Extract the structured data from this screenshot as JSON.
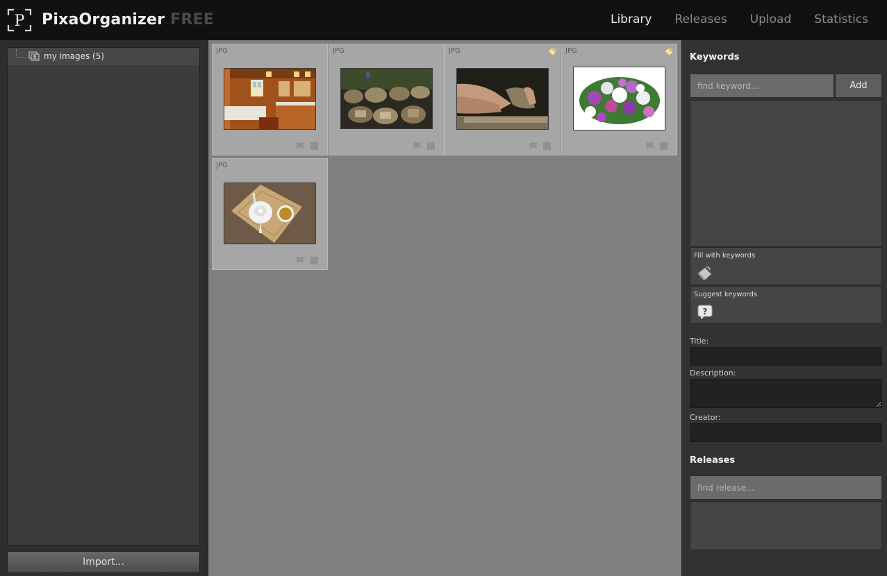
{
  "app": {
    "name": "PixaOrganizer",
    "edition": "FREE",
    "logo_letter": "P"
  },
  "nav": {
    "items": [
      {
        "label": "Library",
        "active": true
      },
      {
        "label": "Releases",
        "active": false
      },
      {
        "label": "Upload",
        "active": false
      },
      {
        "label": "Statistics",
        "active": false
      }
    ]
  },
  "library": {
    "folder_label": "my images (5)",
    "import_label": "Import..."
  },
  "images": [
    {
      "type": "JPG",
      "tagged": false,
      "subject": "wooden-bathroom"
    },
    {
      "type": "JPG",
      "tagged": false,
      "subject": "clay-pottery"
    },
    {
      "type": "JPG",
      "tagged": true,
      "subject": "potter-hands"
    },
    {
      "type": "JPG",
      "tagged": true,
      "subject": "flower-bouquet"
    },
    {
      "type": "JPG",
      "tagged": false,
      "subject": "teapot-on-mat"
    }
  ],
  "keywords": {
    "title": "Keywords",
    "search_placeholder": "find keyword...",
    "add_label": "Add",
    "fill_label": "Fill with keywords",
    "suggest_label": "Suggest keywords"
  },
  "metadata": {
    "title_label": "Title:",
    "title_value": "",
    "description_label": "Description:",
    "description_value": "",
    "creator_label": "Creator:",
    "creator_value": ""
  },
  "releases": {
    "title": "Releases",
    "search_placeholder": "find release..."
  },
  "colors": {
    "header_bg": "#111111",
    "grid_bg": "#808080",
    "card_bg": "#a6a6a6",
    "tag_color": "#f2e4a0"
  }
}
